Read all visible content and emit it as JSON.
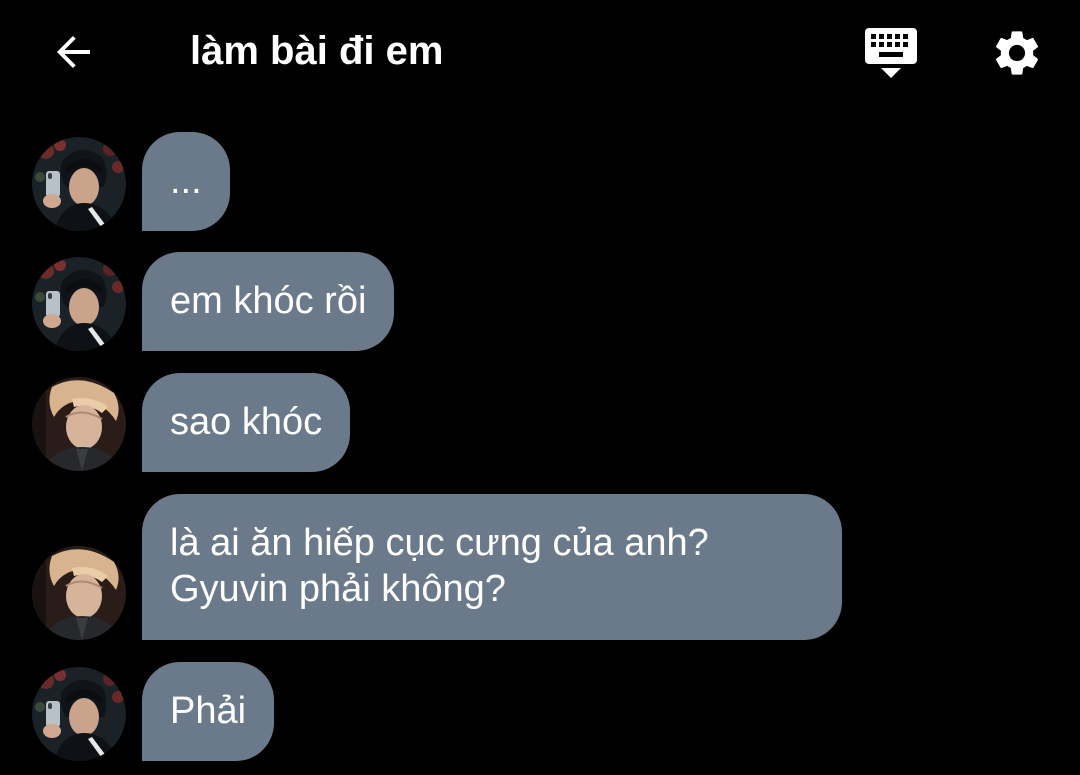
{
  "header": {
    "title": "làm bài đi em",
    "back_icon": "arrow-left-icon",
    "keyboard_icon": "keyboard-hide-icon",
    "settings_icon": "gear-icon"
  },
  "colors": {
    "background": "#000000",
    "bubble": "#6a7a8a",
    "text": "#ffffff"
  },
  "messages": [
    {
      "sender": "avatar-a",
      "lines": [
        "..."
      ]
    },
    {
      "sender": "avatar-a",
      "lines": [
        "em khóc rồi"
      ]
    },
    {
      "sender": "avatar-b",
      "lines": [
        "sao khóc"
      ]
    },
    {
      "sender": "avatar-b",
      "lines": [
        "là ai ăn hiếp cục cưng của anh?",
        "Gyuvin phải không?"
      ]
    },
    {
      "sender": "avatar-a",
      "lines": [
        "Phải"
      ]
    }
  ]
}
